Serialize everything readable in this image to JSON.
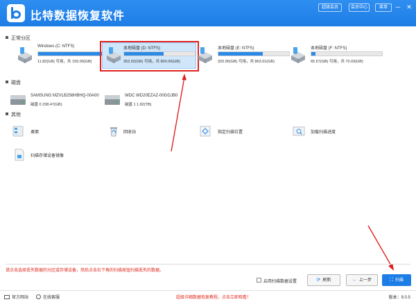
{
  "app": {
    "title": "比特数据恢复软件"
  },
  "titlebar": {
    "buttons": [
      "超级会员",
      "会员中心",
      "菜单"
    ],
    "controls": {
      "minimize": "─",
      "close": "✕"
    }
  },
  "sections": {
    "partitions": "正常分区",
    "disks": "磁盘",
    "others": "其他"
  },
  "partitions": [
    {
      "name": "Windows (C: NTFS)",
      "info": "11.82(GB) 可用，共 159.00(GB)",
      "usage": 0.93
    },
    {
      "name": "本地磁盘 (D: NTFS)",
      "info": "353.92(GB) 可用，共 800.00(GB)",
      "usage": 0.56
    },
    {
      "name": "本地磁盘 (E: NTFS)",
      "info": "320.95(GB) 可用，共 863.01(GB)",
      "usage": 0.63
    },
    {
      "name": "本地磁盘 (F: NTFS)",
      "info": "65.57(GB) 可用，共 70.03(GB)",
      "usage": 0.06
    }
  ],
  "disks": [
    {
      "name": "SAMSUNG MZVLB256HBHQ-00A00",
      "info": "磁盘 0    238.47(GB)"
    },
    {
      "name": "WDC WD20EZAZ-00GGJB0",
      "info": "磁盘 1    1.82(TB)"
    }
  ],
  "others": [
    {
      "label": "桌面",
      "icon": "desktop-icon"
    },
    {
      "label": "回收站",
      "icon": "recycle-bin-icon"
    },
    {
      "label": "指定扫描位置",
      "icon": "location-icon"
    },
    {
      "label": "加载扫描进度",
      "icon": "load-progress-icon"
    },
    {
      "label": "扫描存储设备镜像",
      "icon": "disk-image-icon"
    }
  ],
  "footer": {
    "hint": "请点击选择丢失数据的分区或存储设备，然后点击右下角的扫描按钮扫描丢失的数据。",
    "checkbox_label": "启用扫描数据设置",
    "refresh": "刷新",
    "back": "上一步",
    "scan": "扫描"
  },
  "statusbar": {
    "website": "官方网站",
    "support": "在线客服",
    "tutorial": "超级详细数据恢复教程，点击立即观看！",
    "version": "版本：9.0.5"
  },
  "colors": {
    "accent": "#1c7de6",
    "highlight": "#e02020",
    "hint": "#e0281c"
  }
}
